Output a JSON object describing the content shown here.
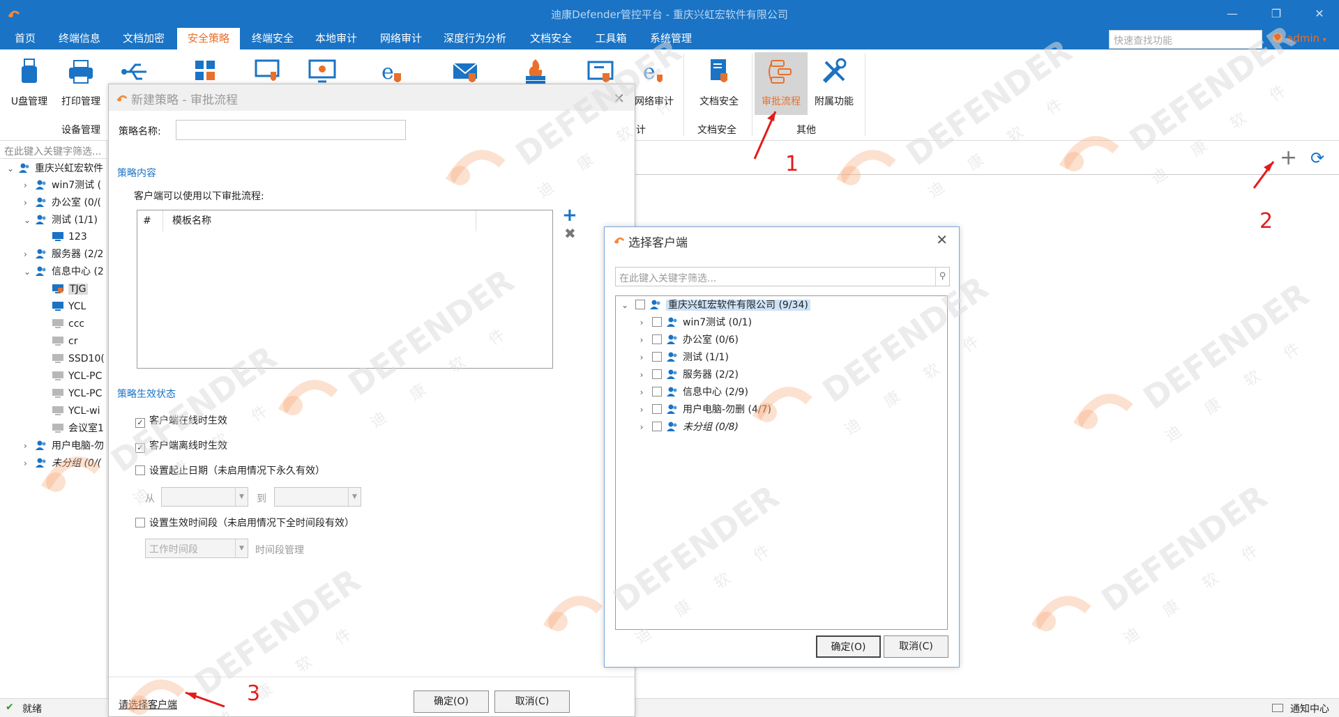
{
  "window": {
    "title": "迪康Defender管控平台 - 重庆兴虹宏软件有限公司",
    "minimize_glyph": "—",
    "restore_glyph": "❐",
    "close_glyph": "✕"
  },
  "menu": {
    "items": [
      "首页",
      "终端信息",
      "文档加密",
      "安全策略",
      "终端安全",
      "本地审计",
      "网络审计",
      "深度行为分析",
      "文档安全",
      "工具箱",
      "系统管理"
    ],
    "active_index": 3,
    "search_placeholder": "快速查找功能",
    "user": "admin"
  },
  "ribbon": {
    "buttons": [
      {
        "label": "U盘管理",
        "icon": "usb-drive-icon"
      },
      {
        "label": "打印管理",
        "icon": "printer-icon"
      },
      {
        "label": "",
        "icon": "usb-icon"
      },
      {
        "label": "",
        "icon": "apps-grid-icon"
      },
      {
        "label": "",
        "icon": "monitor-shield-icon"
      },
      {
        "label": "",
        "icon": "monitor-virus-icon"
      },
      {
        "label": "",
        "icon": "ie-shield-icon"
      },
      {
        "label": "",
        "icon": "mail-shield-icon"
      },
      {
        "label": "",
        "icon": "firewall-icon"
      },
      {
        "label": "",
        "icon": "screen-record-icon"
      },
      {
        "label": "网络审计",
        "icon": "ie-network-icon"
      },
      {
        "label": "文档安全",
        "icon": "document-shield-icon"
      },
      {
        "label": "审批流程",
        "icon": "approval-flow-icon"
      },
      {
        "label": "附属功能",
        "icon": "tools-icon"
      }
    ],
    "groups": {
      "device": "设备管理",
      "audit_partial": "计",
      "doc_security": "文档安全",
      "other": "其他"
    }
  },
  "left_tree": {
    "filter_placeholder": "在此键入关键字筛选...",
    "rows": [
      {
        "label": "重庆兴虹宏软件",
        "toggle": "⌄",
        "type": "group",
        "indent": 0
      },
      {
        "label": "win7测试 (",
        "toggle": "›",
        "type": "group",
        "indent": 1
      },
      {
        "label": "办公室 (0/(",
        "toggle": "›",
        "type": "group",
        "indent": 1
      },
      {
        "label": "测试 (1/1)",
        "toggle": "⌄",
        "type": "group",
        "indent": 1
      },
      {
        "label": "123",
        "toggle": "",
        "type": "pc-on",
        "indent": 2
      },
      {
        "label": "服务器 (2/2",
        "toggle": "›",
        "type": "group",
        "indent": 1
      },
      {
        "label": "信息中心 (2",
        "toggle": "⌄",
        "type": "group",
        "indent": 1
      },
      {
        "label": "TJG",
        "toggle": "",
        "type": "pc-lock",
        "indent": 2
      },
      {
        "label": "YCL",
        "toggle": "",
        "type": "pc-on",
        "indent": 2
      },
      {
        "label": "ccc",
        "toggle": "",
        "type": "pc-off",
        "indent": 2
      },
      {
        "label": "cr",
        "toggle": "",
        "type": "pc-off",
        "indent": 2
      },
      {
        "label": "SSD10(",
        "toggle": "",
        "type": "pc-off",
        "indent": 2
      },
      {
        "label": "YCL-PC",
        "toggle": "",
        "type": "pc-off",
        "indent": 2
      },
      {
        "label": "YCL-PC",
        "toggle": "",
        "type": "pc-off",
        "indent": 2
      },
      {
        "label": "YCL-wi",
        "toggle": "",
        "type": "pc-off",
        "indent": 2
      },
      {
        "label": "会议室1",
        "toggle": "",
        "type": "pc-off",
        "indent": 2
      },
      {
        "label": "用户电脑-勿",
        "toggle": "›",
        "type": "group",
        "indent": 1
      },
      {
        "label": "未分组 (0/(",
        "toggle": "›",
        "type": "group-italic",
        "indent": 1
      }
    ]
  },
  "status": {
    "text": "就绪",
    "notify": "通知中心"
  },
  "policy_dialog": {
    "title": "新建策略 - 审批流程",
    "name_label": "策略名称:",
    "name_value": "",
    "content_section": "策略内容",
    "content_desc": "客户端可以使用以下审批流程:",
    "grid_cols": [
      "#",
      "模板名称"
    ],
    "state_section": "策略生效状态",
    "opt_online": "客户端在线时生效",
    "opt_offline": "客户端离线时生效",
    "opt_date": "设置起止日期（未启用情况下永久有效）",
    "from": "从",
    "to": "到",
    "opt_time": "设置生效时间段（未启用情况下全时间段有效）",
    "time_value": "工作时间段",
    "time_manage": "时间段管理",
    "select_link": "请选择客户端",
    "ok": "确定(O)",
    "cancel": "取消(C)",
    "checked_online": true,
    "checked_offline": true
  },
  "client_dialog": {
    "title": "选择客户端",
    "filter_placeholder": "在此键入关键字筛选...",
    "rows": [
      {
        "label": "重庆兴虹宏软件有限公司 (9/34)",
        "toggle": "⌄",
        "indent": 0,
        "italic": false
      },
      {
        "label": "win7测试 (0/1)",
        "toggle": "›",
        "indent": 1,
        "italic": false
      },
      {
        "label": "办公室 (0/6)",
        "toggle": "›",
        "indent": 1,
        "italic": false
      },
      {
        "label": "测试 (1/1)",
        "toggle": "›",
        "indent": 1,
        "italic": false
      },
      {
        "label": "服务器 (2/2)",
        "toggle": "›",
        "indent": 1,
        "italic": false
      },
      {
        "label": "信息中心 (2/9)",
        "toggle": "›",
        "indent": 1,
        "italic": false
      },
      {
        "label": "用户电脑-勿删 (4/7)",
        "toggle": "›",
        "indent": 1,
        "italic": false
      },
      {
        "label": "未分组 (0/8)",
        "toggle": "›",
        "indent": 1,
        "italic": true
      }
    ],
    "ok": "确定(O)",
    "cancel": "取消(C)"
  },
  "annotations": [
    "1",
    "2",
    "3"
  ],
  "watermark": {
    "text": "DEFENDER",
    "sub": "迪 康 软 件"
  },
  "colors": {
    "brand": "#1a73c4",
    "accent": "#e8702a",
    "annot": "#e31b1b"
  }
}
